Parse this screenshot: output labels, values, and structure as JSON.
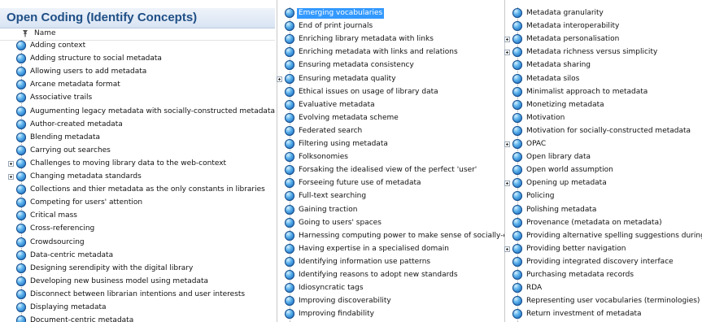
{
  "title": "Open Coding (Identify Concepts)",
  "header": {
    "name": "Name"
  },
  "colors": {
    "title": "#1f4f86",
    "selection": "#3399ff",
    "node": "#2f86d6"
  },
  "columns": [
    {
      "items": [
        {
          "label": "Adding context"
        },
        {
          "label": "Adding structure to social metadata"
        },
        {
          "label": "Allowing users to add metadata"
        },
        {
          "label": "Arcane metadata format"
        },
        {
          "label": "Associative trails"
        },
        {
          "label": "Augumenting legacy metadata with socially-constructed metadata"
        },
        {
          "label": "Author-created metadata"
        },
        {
          "label": "Blending metadata"
        },
        {
          "label": "Carrying out searches"
        },
        {
          "label": "Challenges to moving library data to the web-context",
          "expandable": true
        },
        {
          "label": "Changing metadata standards",
          "expandable": true
        },
        {
          "label": "Collections and thier metadata as the only constants in libraries"
        },
        {
          "label": "Competing for users' attention"
        },
        {
          "label": "Critical mass"
        },
        {
          "label": "Cross-referencing"
        },
        {
          "label": "Crowdsourcing"
        },
        {
          "label": "Data-centric metadata"
        },
        {
          "label": "Designing serendipity with the digital library"
        },
        {
          "label": "Developing new business model using metadata"
        },
        {
          "label": "Disconnect between librarian intentions and user interests"
        },
        {
          "label": "Displaying metadata"
        },
        {
          "label": "Document-centric metadata"
        }
      ]
    },
    {
      "items": [
        {
          "label": "Emerging vocabularies",
          "selected": true
        },
        {
          "label": "End of print journals"
        },
        {
          "label": "Enriching library metadata with links"
        },
        {
          "label": "Enriching metadata with links and relations"
        },
        {
          "label": "Ensuring metadata consistency"
        },
        {
          "label": "Ensuring metadata quality",
          "expandable": true
        },
        {
          "label": "Ethical issues on usage of library data"
        },
        {
          "label": "Evaluative metadata"
        },
        {
          "label": "Evolving metadata scheme"
        },
        {
          "label": "Federated search"
        },
        {
          "label": "Filtering using metadata"
        },
        {
          "label": "Folksonomies"
        },
        {
          "label": "Forsaking the idealised view of the perfect 'user'"
        },
        {
          "label": "Forseeing future use of metadata"
        },
        {
          "label": "Full-text searching"
        },
        {
          "label": "Gaining traction"
        },
        {
          "label": "Going to users' spaces"
        },
        {
          "label": "Harnessing computing power to make sense of socially-c"
        },
        {
          "label": "Having expertise in a specialised domain"
        },
        {
          "label": "Identifying information use patterns"
        },
        {
          "label": "Identifying reasons to adopt new standards"
        },
        {
          "label": "Idiosyncratic tags"
        },
        {
          "label": "Improving discoverability"
        },
        {
          "label": "Improving findability"
        }
      ]
    },
    {
      "items": [
        {
          "label": "Metadata granularity"
        },
        {
          "label": "Metadata interoperability"
        },
        {
          "label": "Metadata personalisation",
          "expandable": true
        },
        {
          "label": "Metadata richness versus simplicity",
          "expandable": true
        },
        {
          "label": "Metadata sharing"
        },
        {
          "label": "Metadata silos"
        },
        {
          "label": "Minimalist approach to metadata"
        },
        {
          "label": "Monetizing metadata"
        },
        {
          "label": "Motivation"
        },
        {
          "label": "Motivation for socially-constructed metadata"
        },
        {
          "label": "OPAC",
          "expandable": true
        },
        {
          "label": "Open library data"
        },
        {
          "label": "Open world assumption"
        },
        {
          "label": "Opening up metadata",
          "expandable": true
        },
        {
          "label": "Policing"
        },
        {
          "label": "Polishing metadata"
        },
        {
          "label": "Provenance (metadata on metadata)"
        },
        {
          "label": "Providing alternative spelling suggestions during"
        },
        {
          "label": "Providing better navigation",
          "expandable": true
        },
        {
          "label": "Providing integrated discovery interface"
        },
        {
          "label": "Purchasing metadata records"
        },
        {
          "label": "RDA"
        },
        {
          "label": "Representing user vocabularies (terminologies)"
        },
        {
          "label": "Return investment of metadata"
        }
      ]
    }
  ]
}
